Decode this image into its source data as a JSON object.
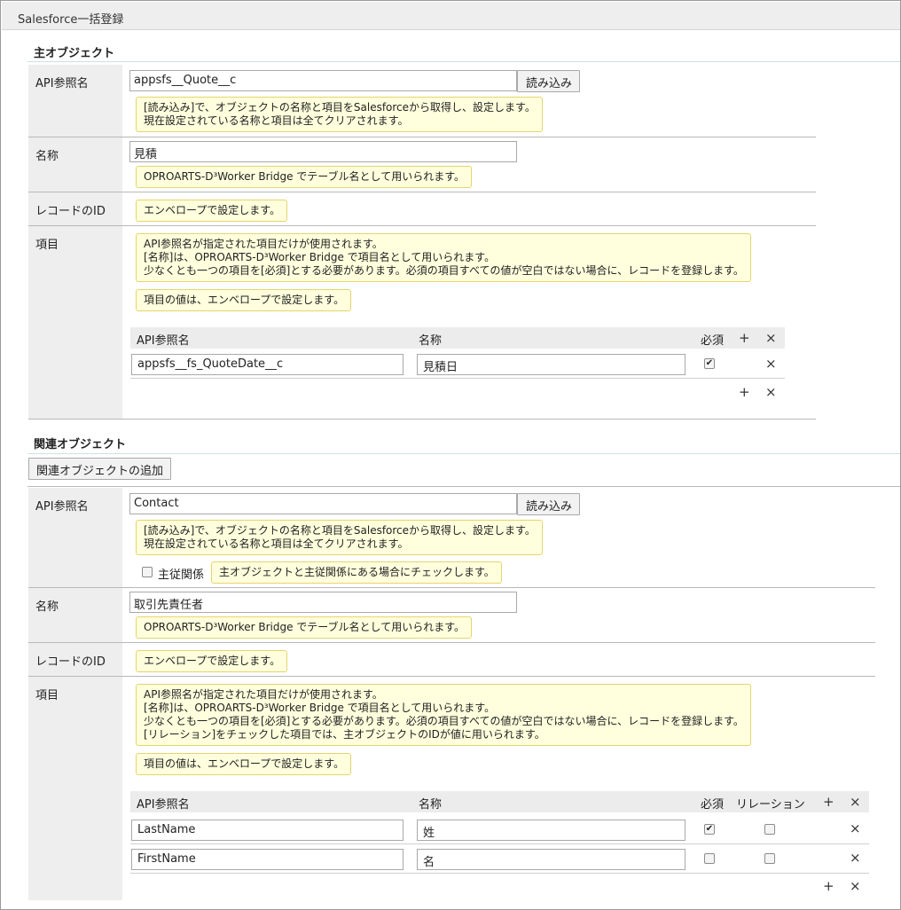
{
  "window": {
    "title": "Salesforce一括登録"
  },
  "labels": {
    "api_name": "API参照名",
    "name": "名称",
    "record_id": "レコードのID",
    "fields": "項目",
    "col_api": "API参照名",
    "col_name": "名称",
    "col_required": "必須",
    "col_relation": "リレーション",
    "load_button": "読み込み",
    "add": "+",
    "remove": "×"
  },
  "notes": {
    "load": "[読み込み]で、オブジェクトの名称と項目をSalesforceから取得し、設定します。\n現在設定されている名称と項目は全てクリアされます。",
    "name": "OPROARTS-D³Worker Bridge でテーブル名として用いられます。",
    "record_id": "エンベロープで設定します。",
    "fields_main": "API参照名が指定された項目だけが使用されます。\n[名称]は、OPROARTS-D³Worker Bridge で項目名として用いられます。\n少なくとも一つの項目を[必須]とする必要があります。必須の項目すべての値が空白ではない場合に、レコードを登録します。",
    "fields_related": "API参照名が指定された項目だけが使用されます。\n[名称]は、OPROARTS-D³Worker Bridge で項目名として用いられます。\n少なくとも一つの項目を[必須]とする必要があります。必須の項目すべての値が空白ではない場合に、レコードを登録します。\n[リレーション]をチェックした項目では、主オブジェクトのIDが値に用いられます。",
    "field_values": "項目の値は、エンベロープで設定します。",
    "master_detail": "主オブジェクトと主従関係にある場合にチェックします。"
  },
  "main_object": {
    "heading": "主オブジェクト",
    "api_name": "appsfs__Quote__c",
    "name": "見積",
    "fields": [
      {
        "api": "appsfs__fs_QuoteDate__c",
        "name": "見積日",
        "required": true
      }
    ]
  },
  "related_object": {
    "heading": "関連オブジェクト",
    "add_button": "関連オブジェクトの追加",
    "api_name": "Contact",
    "name": "取引先責任者",
    "master_detail_label": "主従関係",
    "master_detail_checked": false,
    "fields": [
      {
        "api": "LastName",
        "name": "姓",
        "required": true,
        "relation": false
      },
      {
        "api": "FirstName",
        "name": "名",
        "required": false,
        "relation": false
      }
    ]
  }
}
